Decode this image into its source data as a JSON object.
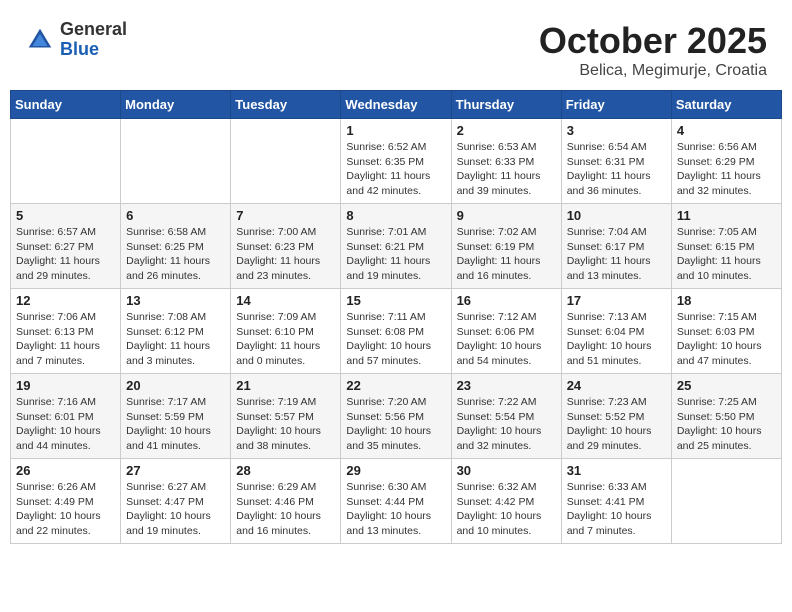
{
  "header": {
    "logo_general": "General",
    "logo_blue": "Blue",
    "month_title": "October 2025",
    "subtitle": "Belica, Megimurje, Croatia"
  },
  "days_of_week": [
    "Sunday",
    "Monday",
    "Tuesday",
    "Wednesday",
    "Thursday",
    "Friday",
    "Saturday"
  ],
  "weeks": [
    [
      {
        "day": "",
        "info": ""
      },
      {
        "day": "",
        "info": ""
      },
      {
        "day": "",
        "info": ""
      },
      {
        "day": "1",
        "info": "Sunrise: 6:52 AM\nSunset: 6:35 PM\nDaylight: 11 hours\nand 42 minutes."
      },
      {
        "day": "2",
        "info": "Sunrise: 6:53 AM\nSunset: 6:33 PM\nDaylight: 11 hours\nand 39 minutes."
      },
      {
        "day": "3",
        "info": "Sunrise: 6:54 AM\nSunset: 6:31 PM\nDaylight: 11 hours\nand 36 minutes."
      },
      {
        "day": "4",
        "info": "Sunrise: 6:56 AM\nSunset: 6:29 PM\nDaylight: 11 hours\nand 32 minutes."
      }
    ],
    [
      {
        "day": "5",
        "info": "Sunrise: 6:57 AM\nSunset: 6:27 PM\nDaylight: 11 hours\nand 29 minutes."
      },
      {
        "day": "6",
        "info": "Sunrise: 6:58 AM\nSunset: 6:25 PM\nDaylight: 11 hours\nand 26 minutes."
      },
      {
        "day": "7",
        "info": "Sunrise: 7:00 AM\nSunset: 6:23 PM\nDaylight: 11 hours\nand 23 minutes."
      },
      {
        "day": "8",
        "info": "Sunrise: 7:01 AM\nSunset: 6:21 PM\nDaylight: 11 hours\nand 19 minutes."
      },
      {
        "day": "9",
        "info": "Sunrise: 7:02 AM\nSunset: 6:19 PM\nDaylight: 11 hours\nand 16 minutes."
      },
      {
        "day": "10",
        "info": "Sunrise: 7:04 AM\nSunset: 6:17 PM\nDaylight: 11 hours\nand 13 minutes."
      },
      {
        "day": "11",
        "info": "Sunrise: 7:05 AM\nSunset: 6:15 PM\nDaylight: 11 hours\nand 10 minutes."
      }
    ],
    [
      {
        "day": "12",
        "info": "Sunrise: 7:06 AM\nSunset: 6:13 PM\nDaylight: 11 hours\nand 7 minutes."
      },
      {
        "day": "13",
        "info": "Sunrise: 7:08 AM\nSunset: 6:12 PM\nDaylight: 11 hours\nand 3 minutes."
      },
      {
        "day": "14",
        "info": "Sunrise: 7:09 AM\nSunset: 6:10 PM\nDaylight: 11 hours\nand 0 minutes."
      },
      {
        "day": "15",
        "info": "Sunrise: 7:11 AM\nSunset: 6:08 PM\nDaylight: 10 hours\nand 57 minutes."
      },
      {
        "day": "16",
        "info": "Sunrise: 7:12 AM\nSunset: 6:06 PM\nDaylight: 10 hours\nand 54 minutes."
      },
      {
        "day": "17",
        "info": "Sunrise: 7:13 AM\nSunset: 6:04 PM\nDaylight: 10 hours\nand 51 minutes."
      },
      {
        "day": "18",
        "info": "Sunrise: 7:15 AM\nSunset: 6:03 PM\nDaylight: 10 hours\nand 47 minutes."
      }
    ],
    [
      {
        "day": "19",
        "info": "Sunrise: 7:16 AM\nSunset: 6:01 PM\nDaylight: 10 hours\nand 44 minutes."
      },
      {
        "day": "20",
        "info": "Sunrise: 7:17 AM\nSunset: 5:59 PM\nDaylight: 10 hours\nand 41 minutes."
      },
      {
        "day": "21",
        "info": "Sunrise: 7:19 AM\nSunset: 5:57 PM\nDaylight: 10 hours\nand 38 minutes."
      },
      {
        "day": "22",
        "info": "Sunrise: 7:20 AM\nSunset: 5:56 PM\nDaylight: 10 hours\nand 35 minutes."
      },
      {
        "day": "23",
        "info": "Sunrise: 7:22 AM\nSunset: 5:54 PM\nDaylight: 10 hours\nand 32 minutes."
      },
      {
        "day": "24",
        "info": "Sunrise: 7:23 AM\nSunset: 5:52 PM\nDaylight: 10 hours\nand 29 minutes."
      },
      {
        "day": "25",
        "info": "Sunrise: 7:25 AM\nSunset: 5:50 PM\nDaylight: 10 hours\nand 25 minutes."
      }
    ],
    [
      {
        "day": "26",
        "info": "Sunrise: 6:26 AM\nSunset: 4:49 PM\nDaylight: 10 hours\nand 22 minutes."
      },
      {
        "day": "27",
        "info": "Sunrise: 6:27 AM\nSunset: 4:47 PM\nDaylight: 10 hours\nand 19 minutes."
      },
      {
        "day": "28",
        "info": "Sunrise: 6:29 AM\nSunset: 4:46 PM\nDaylight: 10 hours\nand 16 minutes."
      },
      {
        "day": "29",
        "info": "Sunrise: 6:30 AM\nSunset: 4:44 PM\nDaylight: 10 hours\nand 13 minutes."
      },
      {
        "day": "30",
        "info": "Sunrise: 6:32 AM\nSunset: 4:42 PM\nDaylight: 10 hours\nand 10 minutes."
      },
      {
        "day": "31",
        "info": "Sunrise: 6:33 AM\nSunset: 4:41 PM\nDaylight: 10 hours\nand 7 minutes."
      },
      {
        "day": "",
        "info": ""
      }
    ]
  ]
}
